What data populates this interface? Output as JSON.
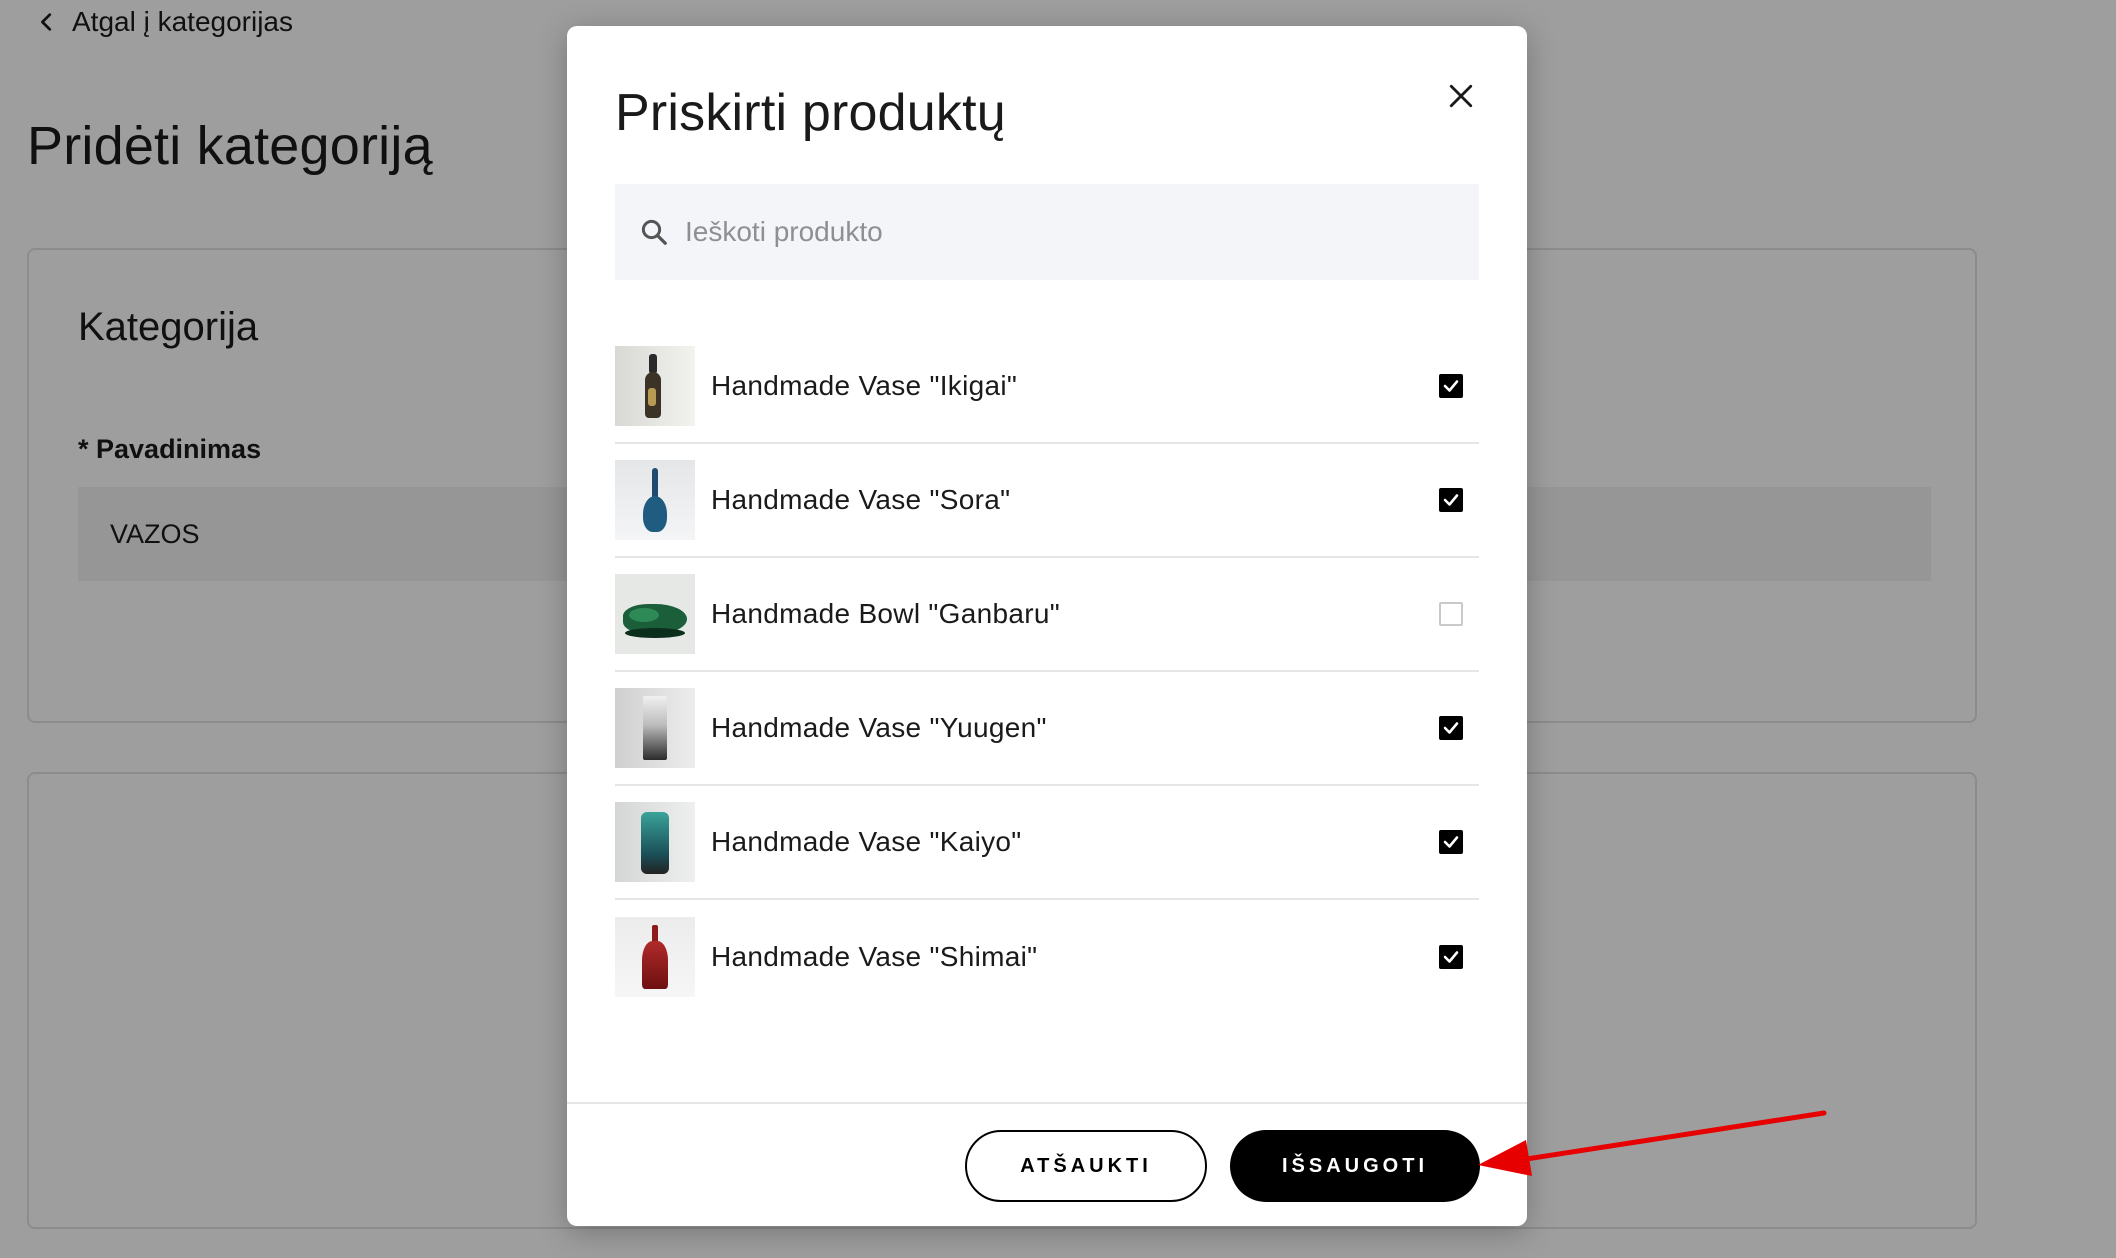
{
  "background": {
    "back_link": "Atgal į kategorijas",
    "page_title": "Pridėti kategoriją",
    "card_title": "Kategorija",
    "field_label": "* Pavadinimas",
    "field_value": "VAZOS"
  },
  "modal": {
    "title": "Priskirti produktų",
    "search_placeholder": "Ieškoti produkto",
    "products": [
      {
        "name": "Handmade Vase \"Ikigai\"",
        "checked": true
      },
      {
        "name": "Handmade Vase \"Sora\"",
        "checked": true
      },
      {
        "name": "Handmade Bowl \"Ganbaru\"",
        "checked": false
      },
      {
        "name": "Handmade Vase \"Yuugen\"",
        "checked": true
      },
      {
        "name": "Handmade Vase \"Kaiyo\"",
        "checked": true
      },
      {
        "name": "Handmade Vase \"Shimai\"",
        "checked": true
      }
    ],
    "cancel_label": "ATŠAUKTI",
    "save_label": "IŠSAUGOTI"
  },
  "colors": {
    "overlay": "rgba(0,0,0,0.38)",
    "primary": "#000000",
    "annotation_arrow": "#e60000"
  },
  "icons": [
    "chevron-left-icon",
    "close-icon",
    "search-icon",
    "checkmark-icon"
  ]
}
